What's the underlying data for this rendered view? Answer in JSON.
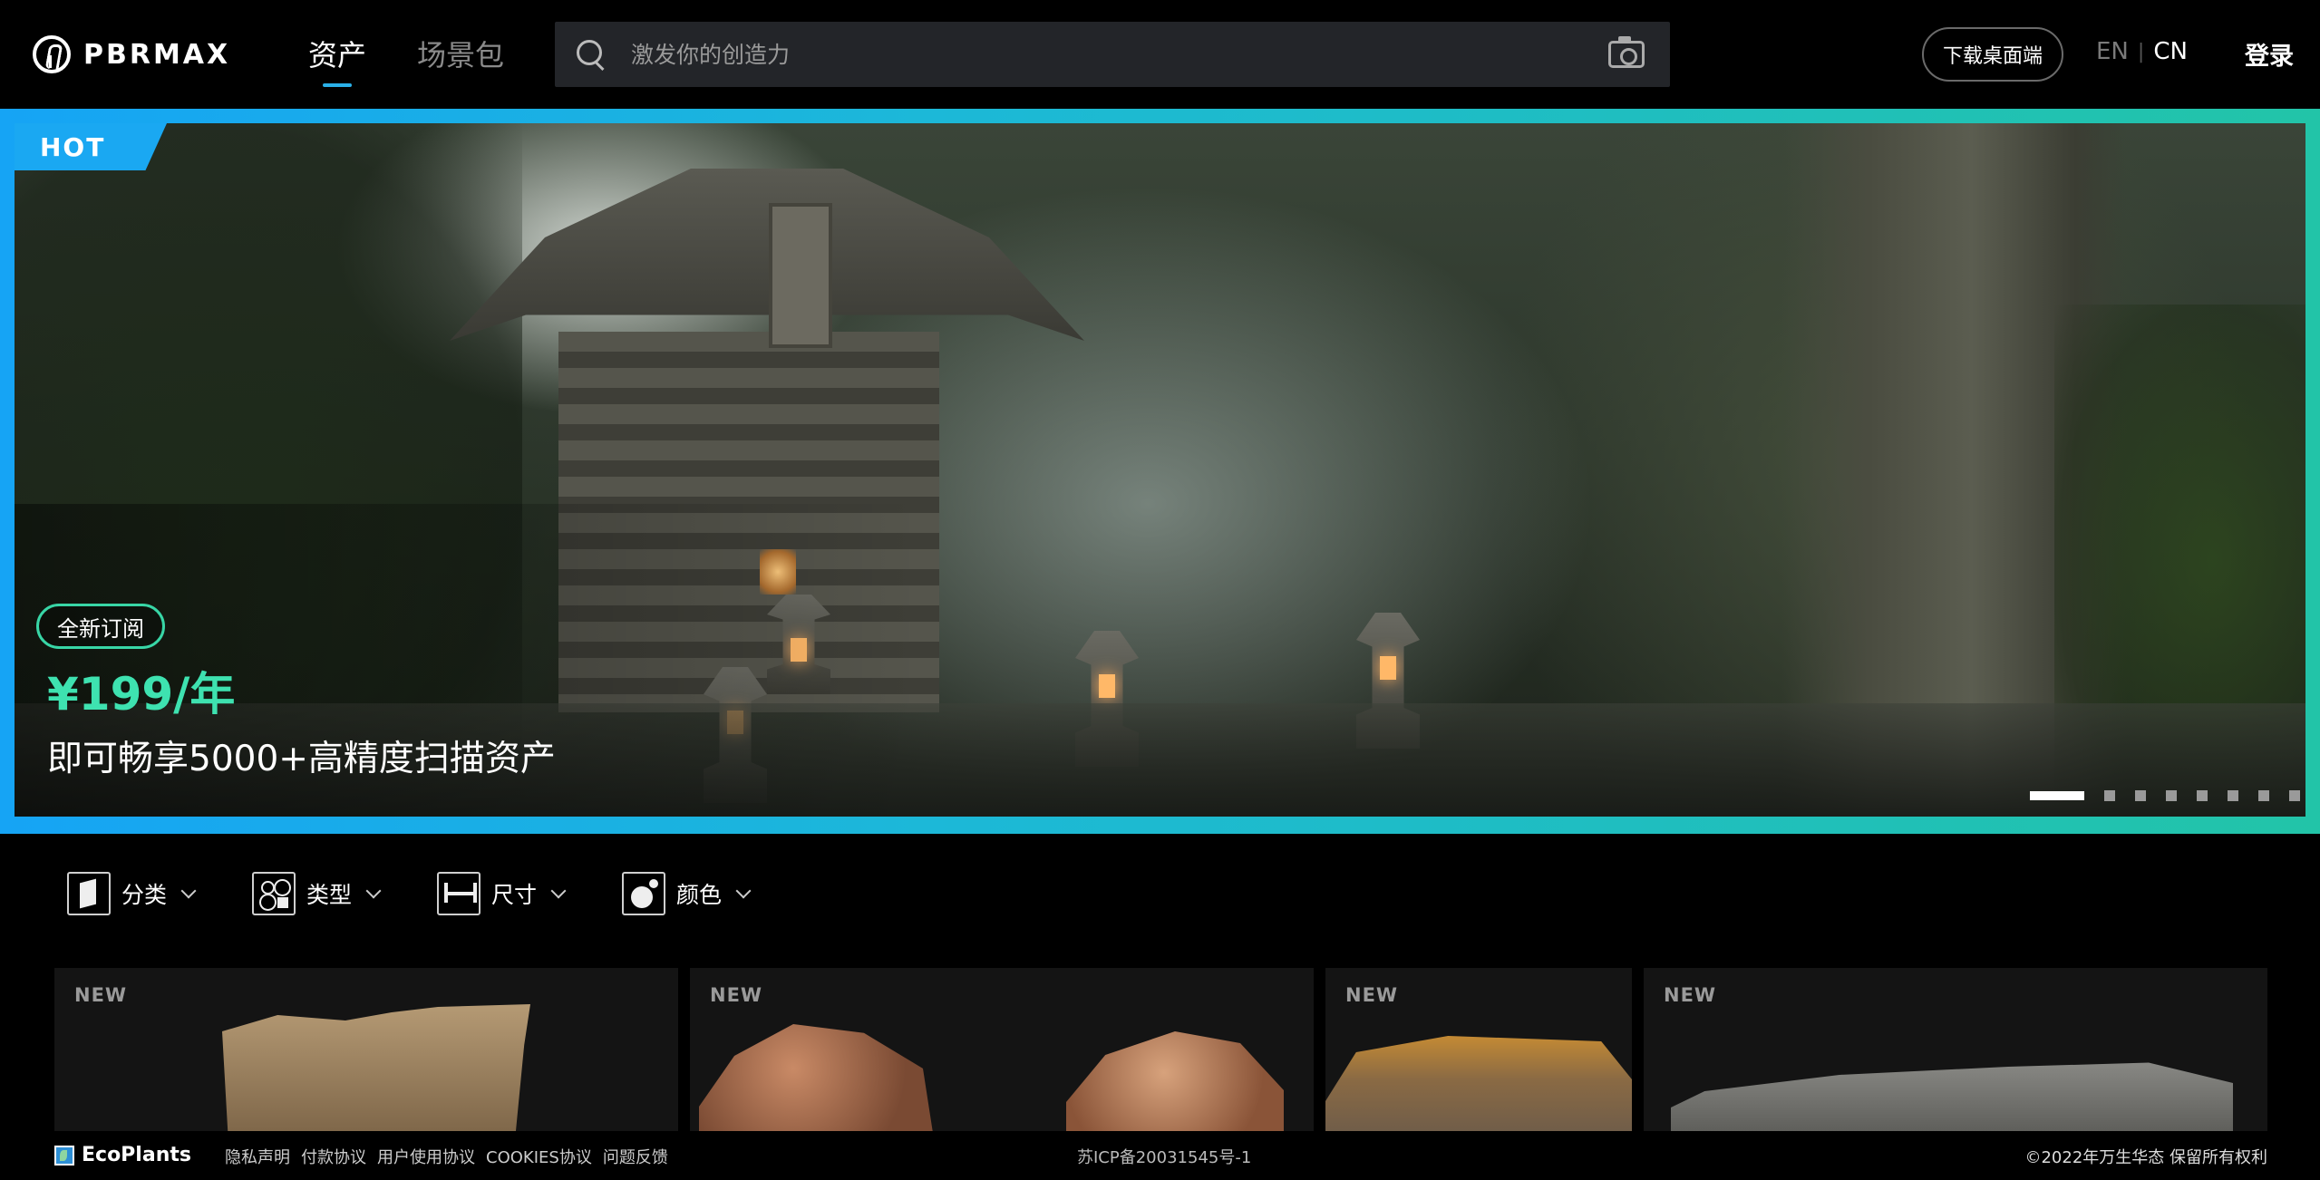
{
  "header": {
    "brand": "PBRMAX",
    "nav": [
      {
        "label": "资产",
        "active": true
      },
      {
        "label": "场景包",
        "active": false
      }
    ],
    "search": {
      "placeholder": "激发你的创造力"
    },
    "download_label": "下载桌面端",
    "lang": {
      "en": "EN",
      "sep": "|",
      "cn": "CN",
      "selected": "CN"
    },
    "login_label": "登录"
  },
  "banner": {
    "badge": "HOT",
    "tag": "全新订阅",
    "price": "¥199/年",
    "description": "即可畅享5000+高精度扫描资产",
    "slides_total": 8,
    "active_slide": 1,
    "colors": {
      "frame_start": "#16a4f5",
      "frame_end": "#22c4a8",
      "price": "#3ee2b0"
    }
  },
  "filters": [
    {
      "label": "分类",
      "icon": "category-icon"
    },
    {
      "label": "类型",
      "icon": "type-icon"
    },
    {
      "label": "尺寸",
      "icon": "size-icon"
    },
    {
      "label": "颜色",
      "icon": "color-icon"
    }
  ],
  "cards": [
    {
      "badge": "NEW"
    },
    {
      "badge": "NEW"
    },
    {
      "badge": "NEW"
    },
    {
      "badge": "NEW"
    }
  ],
  "footer": {
    "brand": "EcoPlants",
    "links": [
      "隐私声明",
      "付款协议",
      "用户使用协议",
      "COOKIES协议",
      "问题反馈"
    ],
    "icp": "苏ICP备20031545号-1",
    "copyright": "©2022年万生华态 保留所有权利"
  }
}
